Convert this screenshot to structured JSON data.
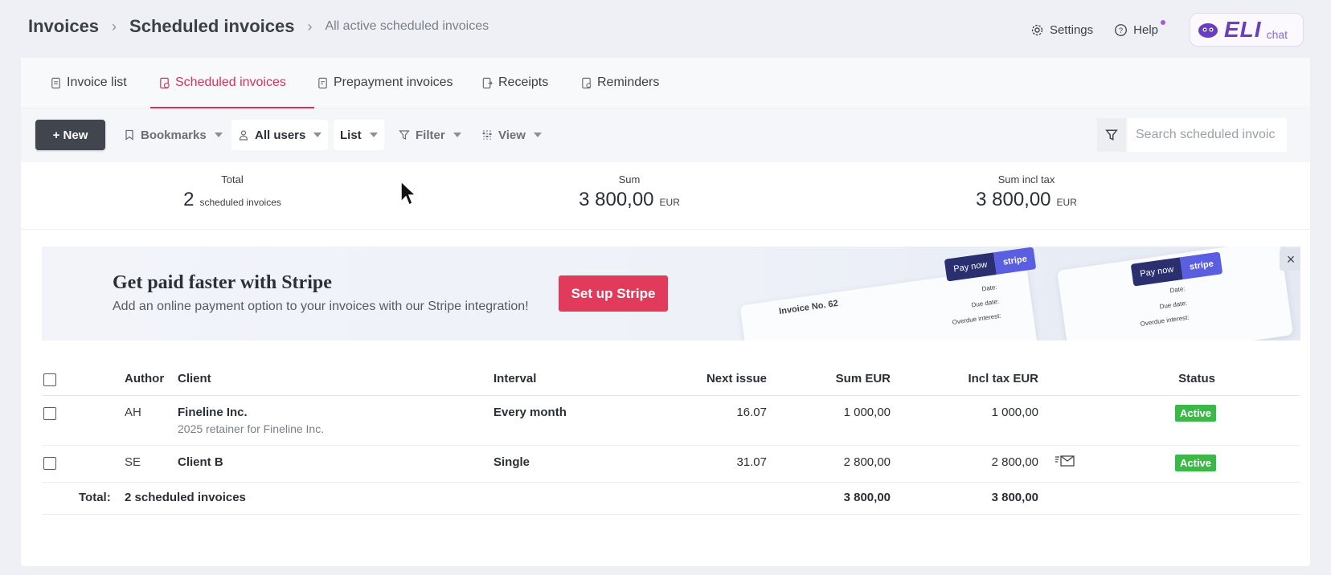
{
  "breadcrumb": {
    "level1": "Invoices",
    "level2": "Scheduled invoices",
    "level3": "All active scheduled invoices"
  },
  "header": {
    "settings_label": "Settings",
    "help_label": "Help",
    "eli_logo": "ELI",
    "eli_chat": "chat"
  },
  "tabs": [
    {
      "label": "Invoice list",
      "icon": "invoice-icon"
    },
    {
      "label": "Scheduled invoices",
      "icon": "scheduled-icon",
      "active": true
    },
    {
      "label": "Prepayment invoices",
      "icon": "prepayment-icon"
    },
    {
      "label": "Receipts",
      "icon": "receipt-icon"
    },
    {
      "label": "Reminders",
      "icon": "reminder-icon"
    }
  ],
  "toolbar": {
    "new_label": "+ New",
    "bookmarks_label": "Bookmarks",
    "users_label": "All users",
    "list_label": "List",
    "filter_label": "Filter",
    "view_label": "View",
    "search_placeholder": "Search scheduled invoic"
  },
  "summary": {
    "total_label": "Total",
    "total_value": "2",
    "total_unit": "scheduled invoices",
    "sum_label": "Sum",
    "sum_value": "3 800,00",
    "sum_unit": "EUR",
    "sum_tax_label": "Sum incl tax",
    "sum_tax_value": "3 800,00",
    "sum_tax_unit": "EUR"
  },
  "banner": {
    "title": "Get paid faster with Stripe",
    "subtitle": "Add an online payment option to your invoices with our Stripe integration!",
    "button_label": "Set up Stripe",
    "close_label": "×",
    "illustration": {
      "invoice_title": "Invoice No. 62",
      "pay_now": "Pay now",
      "stripe": "stripe",
      "date_label": "Date:",
      "due_date_label": "Due date:",
      "overdue_label": "Overdue interest:"
    }
  },
  "table": {
    "headers": {
      "author": "Author",
      "client": "Client",
      "interval": "Interval",
      "next_issue": "Next issue",
      "sum": "Sum EUR",
      "incl_tax": "Incl tax EUR",
      "status": "Status"
    },
    "rows": [
      {
        "author": "AH",
        "client": "Fineline Inc.",
        "description": "2025 retainer for Fineline Inc.",
        "interval": "Every month",
        "next_issue": "16.07",
        "sum": "1 000,00",
        "incl_tax": "1 000,00",
        "status": "Active"
      },
      {
        "author": "SE",
        "client": "Client B",
        "description": "",
        "interval": "Single",
        "next_issue": "31.07",
        "sum": "2 800,00",
        "incl_tax": "2 800,00",
        "status": "Active",
        "has_mail_icon": true
      }
    ],
    "total": {
      "label": "Total:",
      "count": "2 scheduled invoices",
      "sum": "3 800,00",
      "incl_tax": "3 800,00"
    }
  },
  "colors": {
    "accent": "#d6325a",
    "stripe_button": "#e23a5a",
    "status_active": "#3bb847",
    "new_button": "#41454d"
  }
}
